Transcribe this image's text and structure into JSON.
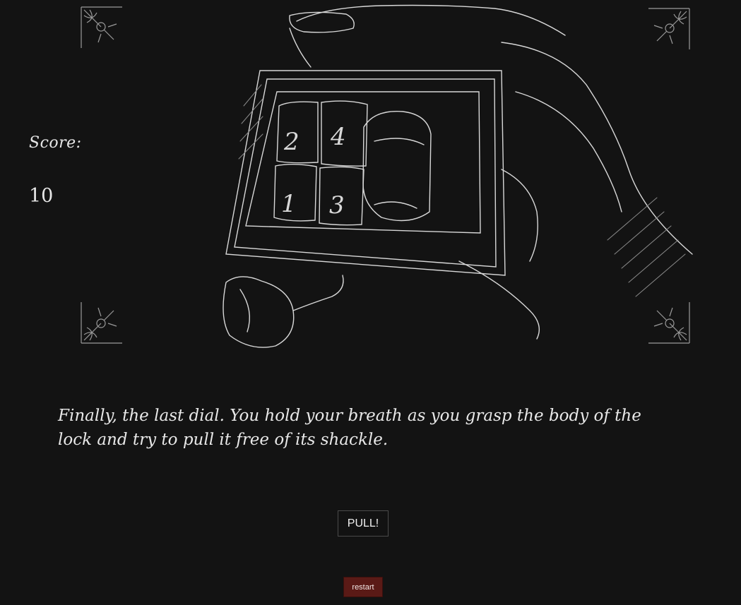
{
  "score": {
    "label": "Score:",
    "value": "10"
  },
  "illustration": {
    "dial_digits": [
      "2",
      "4",
      "1",
      "3"
    ],
    "corner_ornament_icon": "fleur-corner-icon"
  },
  "story": {
    "text": "Finally, the last dial. You hold your breath as you grasp the body of the lock and try to pull it free of its shackle."
  },
  "actions": {
    "pull_label": "PULL!",
    "restart_label": "restart"
  },
  "colors": {
    "background": "#131313",
    "text": "#e8e8e8",
    "restart_bg": "#5a1a16"
  }
}
